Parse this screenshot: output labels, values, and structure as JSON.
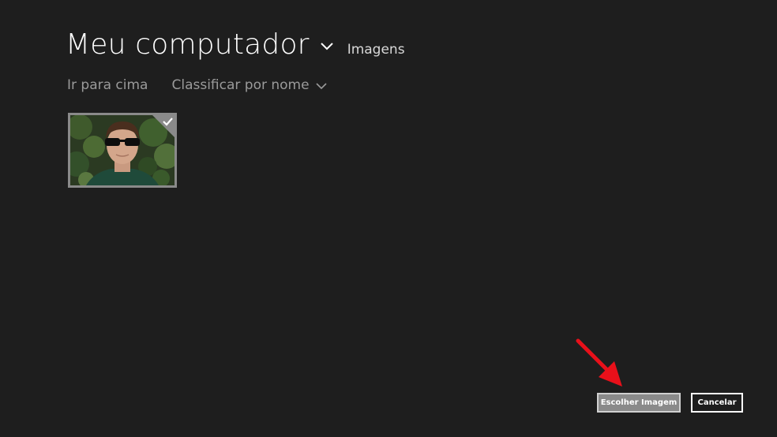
{
  "header": {
    "title": "Meu computador",
    "subfolder": "Imagens"
  },
  "toolbar": {
    "go_up": "Ir para cima",
    "sort": "Classificar por nome"
  },
  "files": [
    {
      "selected": true
    }
  ],
  "actions": {
    "choose": "Escolher Imagem",
    "cancel": "Cancelar"
  },
  "colors": {
    "background": "#1e1e1e",
    "primary_button": "#8a8a8a",
    "annotation_arrow": "#e8101a"
  },
  "icons": [
    "chevron-down-icon",
    "checkmark-icon",
    "red-arrow-icon"
  ]
}
